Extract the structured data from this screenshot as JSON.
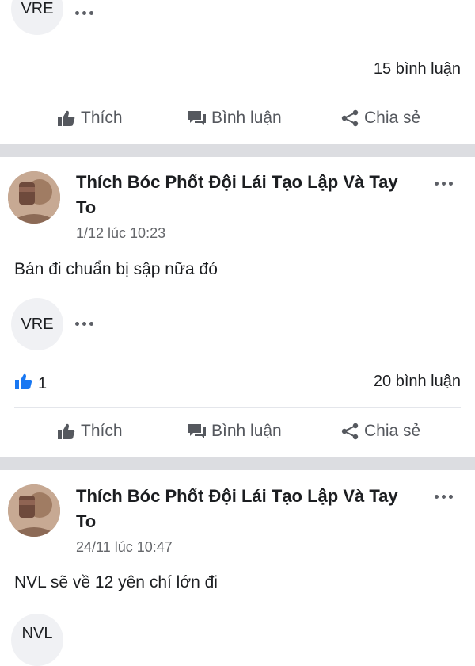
{
  "top_post": {
    "tag": "VRE",
    "comments": "15 bình luận",
    "actions": {
      "like": "Thích",
      "comment": "Bình luận",
      "share": "Chia sẻ"
    }
  },
  "posts": [
    {
      "author": "Thích Bóc Phốt Đội Lái Tạo Lập Và Tay To",
      "time": "1/12 lúc 10:23",
      "text": "Bán đi chuẩn bị sập nữa đó",
      "tag": "VRE",
      "likes": "1",
      "comments": "20 bình luận",
      "actions": {
        "like": "Thích",
        "comment": "Bình luận",
        "share": "Chia sẻ"
      }
    },
    {
      "author": "Thích Bóc Phốt Đội Lái Tạo Lập Và Tay To",
      "time": "24/11 lúc 10:47",
      "text": "NVL sẽ về 12 yên chí lớn đi",
      "tag": "NVL"
    }
  ],
  "colors": {
    "like_blue": "#1877f2",
    "separator": "#dcdde1",
    "tag_bg": "#f0f1f4"
  }
}
